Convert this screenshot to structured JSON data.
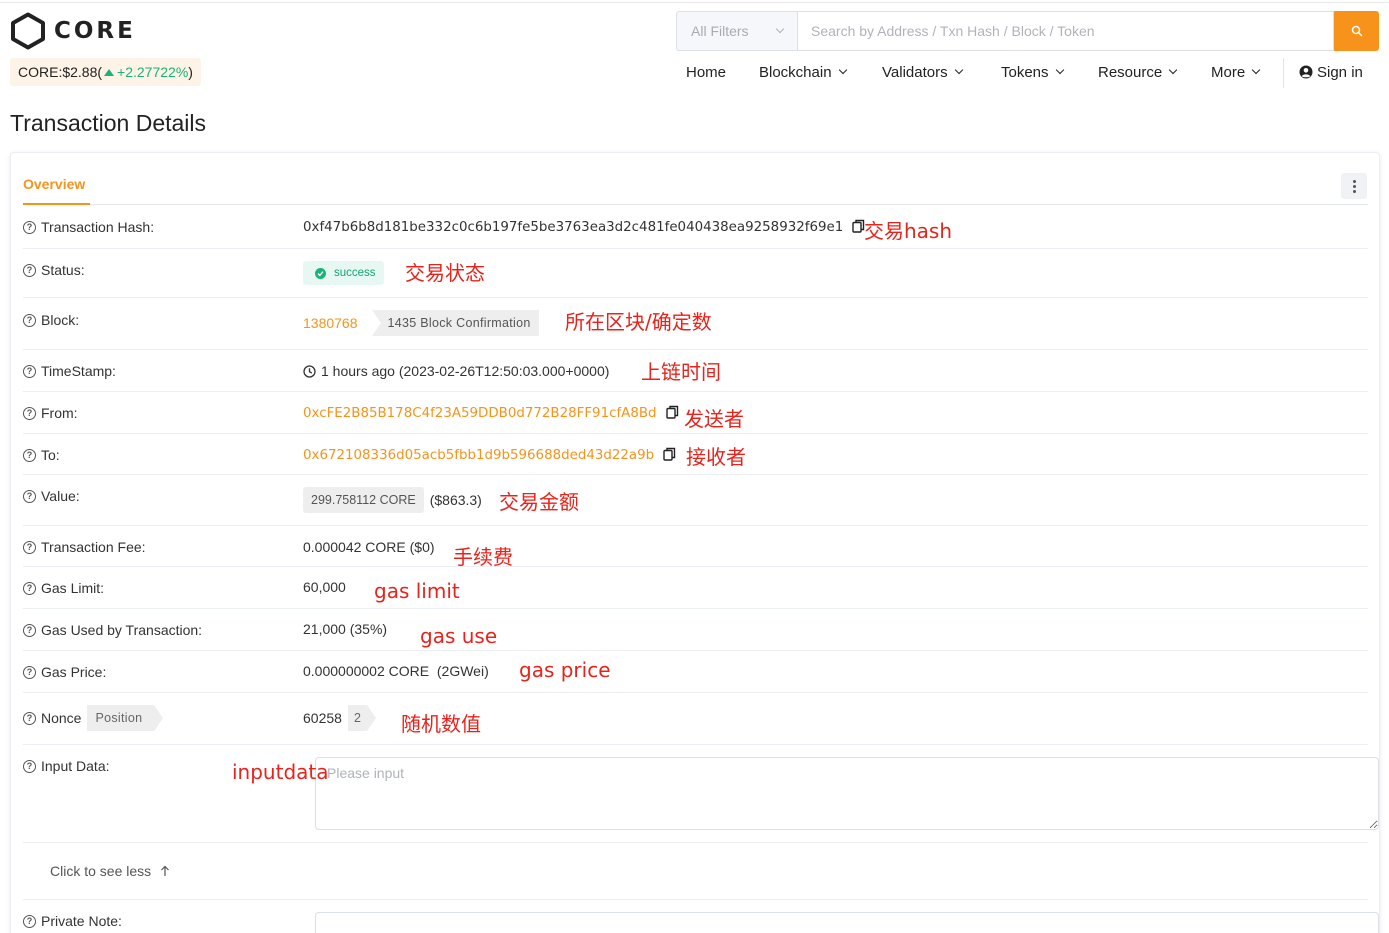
{
  "header": {
    "logo_text": "CORE",
    "price_label": "CORE:$2.88(",
    "price_change": "+2.27722%",
    "price_close": ")",
    "search": {
      "filter_label": "All Filters",
      "placeholder": "Search by Address / Txn Hash / Block / Token"
    },
    "nav": [
      {
        "label": "Home"
      },
      {
        "label": "Blockchain"
      },
      {
        "label": "Validators"
      },
      {
        "label": "Tokens"
      },
      {
        "label": "Resource"
      },
      {
        "label": "More"
      }
    ],
    "sign_in": "Sign in"
  },
  "page": {
    "title": "Transaction Details",
    "tab": "Overview"
  },
  "fields": {
    "hash": {
      "label": "Transaction Hash:",
      "value": "0xf47b6b8d181be332c0c6b197fe5be3763ea3d2c481fe040438ea9258932f69e1",
      "note": "交易hash"
    },
    "status": {
      "label": "Status:",
      "value": "success",
      "note": "交易状态"
    },
    "block": {
      "label": "Block:",
      "value": "1380768",
      "confirmations": "1435 Block Confirmation",
      "note": "所在区块/确定数"
    },
    "timestamp": {
      "label": "TimeStamp:",
      "value": "1 hours ago (2023-02-26T12:50:03.000+0000)",
      "note": "上链时间"
    },
    "from": {
      "label": "From:",
      "value": "0xcFE2B85B178C4f23A59DDB0d772B28FF91cfA8Bd",
      "note": "发送者"
    },
    "to": {
      "label": "To:",
      "value": "0x672108336d05acb5fbb1d9b596688ded43d22a9b",
      "note": "接收者"
    },
    "value": {
      "label": "Value:",
      "amount": "299.758112 CORE",
      "usd": "($863.3)",
      "note": "交易金额"
    },
    "fee": {
      "label": "Transaction Fee:",
      "value": "0.000042 CORE ($0)",
      "note": "手续费"
    },
    "gas_limit": {
      "label": "Gas Limit:",
      "value": "60,000",
      "note": "gas limit"
    },
    "gas_used": {
      "label": "Gas Used by Transaction:",
      "value": "21,000 (35%)",
      "note": "gas use"
    },
    "gas_price": {
      "label": "Gas Price:",
      "value": "0.000000002 CORE  (2GWei)",
      "note": "gas price"
    },
    "nonce": {
      "label": "Nonce",
      "position_tag": "Position",
      "value": "60258",
      "position": "2",
      "note": "随机数值"
    },
    "input": {
      "label": "Input Data:",
      "placeholder": "Please input",
      "note": "inputdata"
    },
    "see_less": "Click to see less",
    "private_note": {
      "label": "Private Note:"
    }
  },
  "colors": {
    "accent": "#f7931a",
    "success": "#1bb37a",
    "annotation": "#e8231b"
  }
}
